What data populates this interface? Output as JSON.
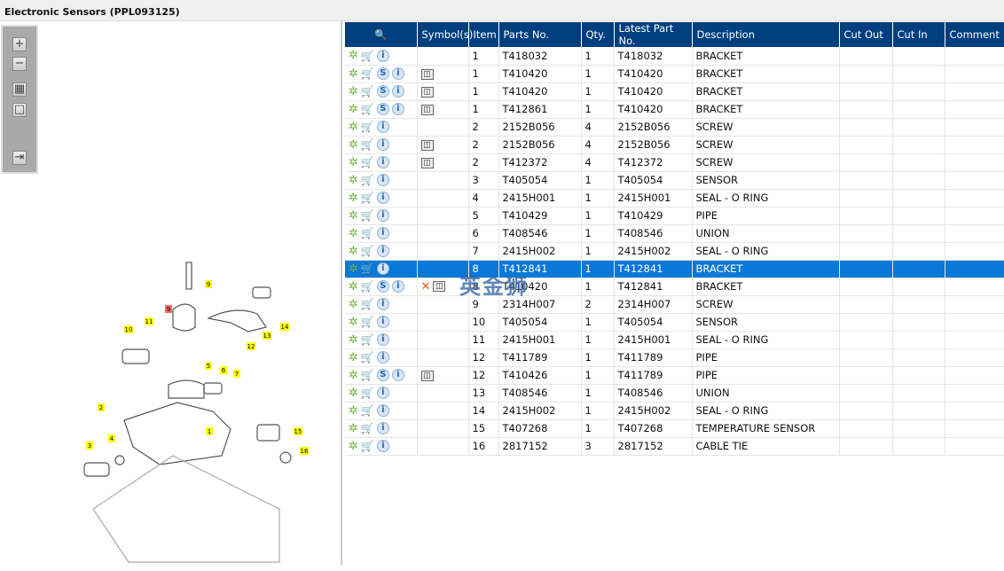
{
  "title": "Electronic Sensors (PPL093125)",
  "toolbar": [
    "zoom-in",
    "zoom-out",
    "fit-all",
    "actual-size",
    "toggle-panel"
  ],
  "watermark": "英金狮",
  "diagram": {
    "callouts": [
      "9",
      "9",
      "10",
      "11",
      "12",
      "13",
      "14",
      "5",
      "6",
      "7",
      "2",
      "1",
      "4",
      "3",
      "15",
      "16"
    ]
  },
  "columns": [
    "",
    "Symbol(s)",
    "Item",
    "Parts No.",
    "Qty.",
    "Latest Part No.",
    "Description",
    "Cut Out",
    "Cut In",
    "Comment"
  ],
  "rows": [
    {
      "s": false,
      "sym": false,
      "x": false,
      "item": "1",
      "part": "T418032",
      "qty": "1",
      "latest": "T418032",
      "desc": "BRACKET"
    },
    {
      "s": true,
      "sym": true,
      "x": false,
      "item": "1",
      "part": "T410420",
      "qty": "1",
      "latest": "T410420",
      "desc": "BRACKET"
    },
    {
      "s": true,
      "sym": true,
      "x": false,
      "item": "1",
      "part": "T410420",
      "qty": "1",
      "latest": "T410420",
      "desc": "BRACKET"
    },
    {
      "s": true,
      "sym": true,
      "x": false,
      "item": "1",
      "part": "T412861",
      "qty": "1",
      "latest": "T410420",
      "desc": "BRACKET"
    },
    {
      "s": false,
      "sym": false,
      "x": false,
      "item": "2",
      "part": "2152B056",
      "qty": "4",
      "latest": "2152B056",
      "desc": "SCREW"
    },
    {
      "s": false,
      "sym": true,
      "x": false,
      "item": "2",
      "part": "2152B056",
      "qty": "4",
      "latest": "2152B056",
      "desc": "SCREW"
    },
    {
      "s": false,
      "sym": true,
      "x": false,
      "item": "2",
      "part": "T412372",
      "qty": "4",
      "latest": "T412372",
      "desc": "SCREW"
    },
    {
      "s": false,
      "sym": false,
      "x": false,
      "item": "3",
      "part": "T405054",
      "qty": "1",
      "latest": "T405054",
      "desc": "SENSOR"
    },
    {
      "s": false,
      "sym": false,
      "x": false,
      "item": "4",
      "part": "2415H001",
      "qty": "1",
      "latest": "2415H001",
      "desc": "SEAL - O RING"
    },
    {
      "s": false,
      "sym": false,
      "x": false,
      "item": "5",
      "part": "T410429",
      "qty": "1",
      "latest": "T410429",
      "desc": "PIPE"
    },
    {
      "s": false,
      "sym": false,
      "x": false,
      "item": "6",
      "part": "T408546",
      "qty": "1",
      "latest": "T408546",
      "desc": "UNION"
    },
    {
      "s": false,
      "sym": false,
      "x": false,
      "item": "7",
      "part": "2415H002",
      "qty": "1",
      "latest": "2415H002",
      "desc": "SEAL - O RING"
    },
    {
      "s": false,
      "sym": false,
      "x": false,
      "item": "8",
      "part": "T412841",
      "qty": "1",
      "latest": "T412841",
      "desc": "BRACKET",
      "selected": true
    },
    {
      "s": true,
      "sym": true,
      "x": true,
      "item": "8",
      "part": "T410420",
      "qty": "1",
      "latest": "T412841",
      "desc": "BRACKET"
    },
    {
      "s": false,
      "sym": false,
      "x": false,
      "item": "9",
      "part": "2314H007",
      "qty": "2",
      "latest": "2314H007",
      "desc": "SCREW"
    },
    {
      "s": false,
      "sym": false,
      "x": false,
      "item": "10",
      "part": "T405054",
      "qty": "1",
      "latest": "T405054",
      "desc": "SENSOR"
    },
    {
      "s": false,
      "sym": false,
      "x": false,
      "item": "11",
      "part": "2415H001",
      "qty": "1",
      "latest": "2415H001",
      "desc": "SEAL - O RING"
    },
    {
      "s": false,
      "sym": false,
      "x": false,
      "item": "12",
      "part": "T411789",
      "qty": "1",
      "latest": "T411789",
      "desc": "PIPE"
    },
    {
      "s": true,
      "sym": true,
      "x": false,
      "item": "12",
      "part": "T410426",
      "qty": "1",
      "latest": "T411789",
      "desc": "PIPE"
    },
    {
      "s": false,
      "sym": false,
      "x": false,
      "item": "13",
      "part": "T408546",
      "qty": "1",
      "latest": "T408546",
      "desc": "UNION"
    },
    {
      "s": false,
      "sym": false,
      "x": false,
      "item": "14",
      "part": "2415H002",
      "qty": "1",
      "latest": "2415H002",
      "desc": "SEAL - O RING"
    },
    {
      "s": false,
      "sym": false,
      "x": false,
      "item": "15",
      "part": "T407268",
      "qty": "1",
      "latest": "T407268",
      "desc": "TEMPERATURE SENSOR"
    },
    {
      "s": false,
      "sym": false,
      "x": false,
      "item": "16",
      "part": "2817152",
      "qty": "3",
      "latest": "2817152",
      "desc": "CABLE TIE"
    }
  ]
}
